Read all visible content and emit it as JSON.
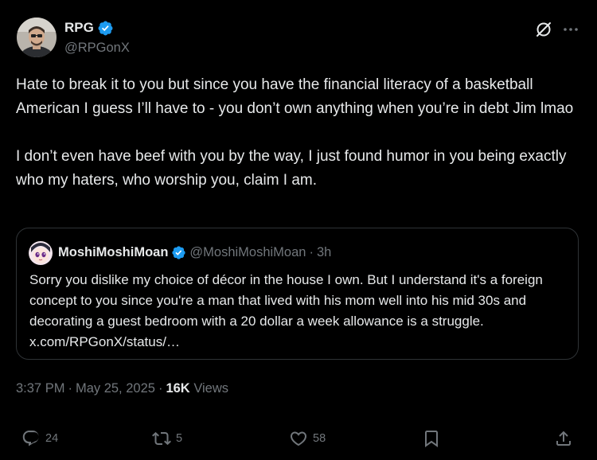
{
  "colors": {
    "background": "#000000",
    "text": "#e7e9ea",
    "secondary_text": "#71767b",
    "border": "#2f3336",
    "verified_blue": "#1d9bf0"
  },
  "author": {
    "display_name": "RPG",
    "handle": "@RPGonX",
    "verified": true,
    "avatar_icon": "profile-photo"
  },
  "header_icons": [
    "grok-icon",
    "more-icon"
  ],
  "tweet": {
    "paragraphs": [
      "Hate to break it to you but since you have the financial literacy of a basketball American I guess I’ll have to - you don’t own anything when you’re in debt Jim lmao",
      "I don’t even have beef with you by the way, I just found humor in you being exactly who my haters, who worship you, claim I am."
    ]
  },
  "quote": {
    "display_name": "MoshiMoshiMoan",
    "handle": "@MoshiMoshiMoan",
    "separator": "·",
    "time": "3h",
    "verified": true,
    "avatar_icon": "anime-avatar",
    "text": "Sorry you dislike my choice of décor in the house I own.  But I understand it's a foreign concept to you since you're a man that lived with his mom well into his mid 30s and decorating a guest bedroom with a 20 dollar a week allowance is a struggle. x.com/RPGonX/status/…"
  },
  "meta": {
    "time": "3:37 PM",
    "sep1": "·",
    "date": "May 25, 2025",
    "sep2": "·",
    "views_count": "16K",
    "views_label": "Views"
  },
  "actions": {
    "replies": "24",
    "reposts": "5",
    "likes": "58",
    "icons": [
      "reply-icon",
      "repost-icon",
      "like-icon",
      "bookmark-icon",
      "share-icon"
    ]
  }
}
